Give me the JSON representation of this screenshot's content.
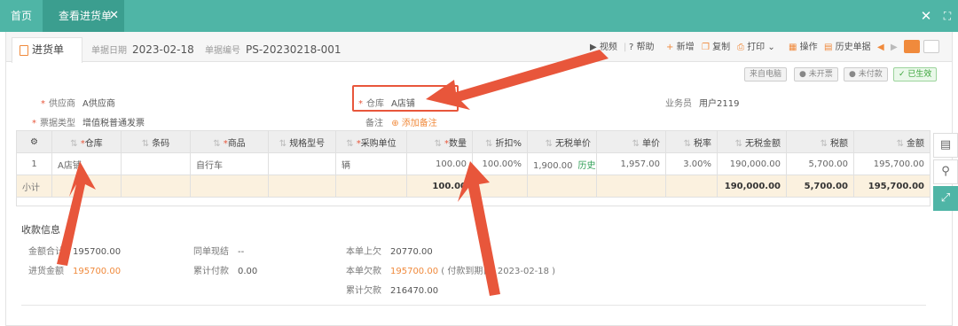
{
  "tabs": {
    "home": "首页",
    "active": "查看进货单"
  },
  "window_buttons": {
    "close": "✕",
    "expand": "⛶"
  },
  "doc": {
    "tab_label": "进货单",
    "date_label": "单据日期",
    "date_value": "2023-02-18",
    "no_label": "单据编号",
    "no_value": "PS-20230218-001"
  },
  "toolbar": {
    "video": "视频",
    "help": "帮助",
    "add": "新增",
    "copy": "复制",
    "print": "打印",
    "ops": "操作",
    "history": "历史单据"
  },
  "badges": {
    "source": "来自电脑",
    "invoice": "未开票",
    "payment": "未付款",
    "status": "已生效"
  },
  "form": {
    "supplier_label": "供应商",
    "supplier_value": "A供应商",
    "warehouse_label": "仓库",
    "warehouse_value": "A店铺",
    "salesman_label": "业务员",
    "salesman_value": "用户2119",
    "invoice_type_label": "票据类型",
    "invoice_type_value": "增值税普通发票",
    "remark_label": "备注",
    "add_remark": "添加备注"
  },
  "table": {
    "headers": [
      "仓库",
      "条码",
      "商品",
      "规格型号",
      "采购单位",
      "数量",
      "折扣%",
      "无税单价",
      "单价",
      "税率",
      "无税金额",
      "税额",
      "金额"
    ],
    "row": {
      "index": "1",
      "warehouse": "A店铺",
      "barcode": "",
      "product": "自行车",
      "spec": "",
      "unit": "辆",
      "qty": "100.00",
      "discount": "100.00%",
      "net_price": "1,900.00",
      "history": "历史",
      "price": "1,957.00",
      "tax_rate": "3.00%",
      "net_amount": "190,000.00",
      "tax": "5,700.00",
      "amount": "195,700.00"
    },
    "subtotal": {
      "label": "小计",
      "qty": "100.00",
      "net_amount": "190,000.00",
      "tax": "5,700.00",
      "amount": "195,700.00"
    }
  },
  "payment": {
    "title": "收款信息",
    "total_label": "金额合计",
    "total_value": "195700.00",
    "purchase_label": "进货金额",
    "purchase_value": "195700.00",
    "same_label": "同单现结",
    "same_value": "--",
    "paid_label": "累计付款",
    "paid_value": "0.00",
    "prev_debt_label": "本单上欠",
    "prev_debt_value": "20770.00",
    "debt_label": "本单欠款",
    "debt_value": "195700.00",
    "due_note": "( 付款到期日: 2023-02-18 )",
    "total_debt_label": "累计欠款",
    "total_debt_value": "216470.00"
  },
  "colors": {
    "teal": "#4fb5a6",
    "orange": "#f08a3c",
    "required": "#e8563b",
    "arrow": "#e8563b",
    "subtotal_bg": "#fbf1df"
  }
}
